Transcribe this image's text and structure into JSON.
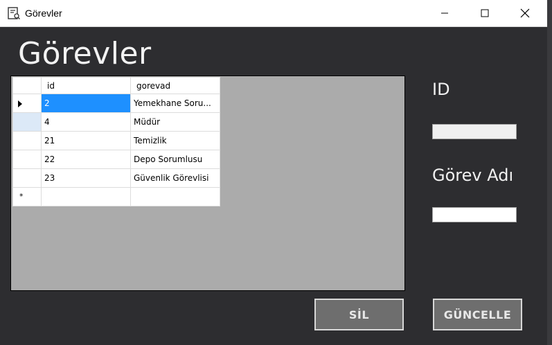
{
  "window": {
    "title": "Görevler",
    "heading": "Görevler"
  },
  "titlebar_icons": {
    "app": "form-icon",
    "minimize": "minimize-icon",
    "maximize": "maximize-icon",
    "close": "close-icon"
  },
  "grid": {
    "columns": [
      "id",
      "gorevad"
    ],
    "rows": [
      {
        "id": "2",
        "gorevad": "Yemekhane Soru..."
      },
      {
        "id": "4",
        "gorevad": "Müdür"
      },
      {
        "id": "21",
        "gorevad": "Temizlik"
      },
      {
        "id": "22",
        "gorevad": "Depo Sorumlusu"
      },
      {
        "id": "23",
        "gorevad": "Güvenlik Görevlisi"
      }
    ],
    "new_row_marker": "*"
  },
  "form": {
    "id_label": "ID",
    "id_value": "",
    "gorev_label": "Görev Adı",
    "gorev_value": ""
  },
  "buttons": {
    "delete": "SİL",
    "update": "GÜNCELLE"
  },
  "colors": {
    "background": "#2d2d30",
    "grid_background": "#ababab",
    "selection": "#1e90ff",
    "button": "#6e6e6e"
  }
}
